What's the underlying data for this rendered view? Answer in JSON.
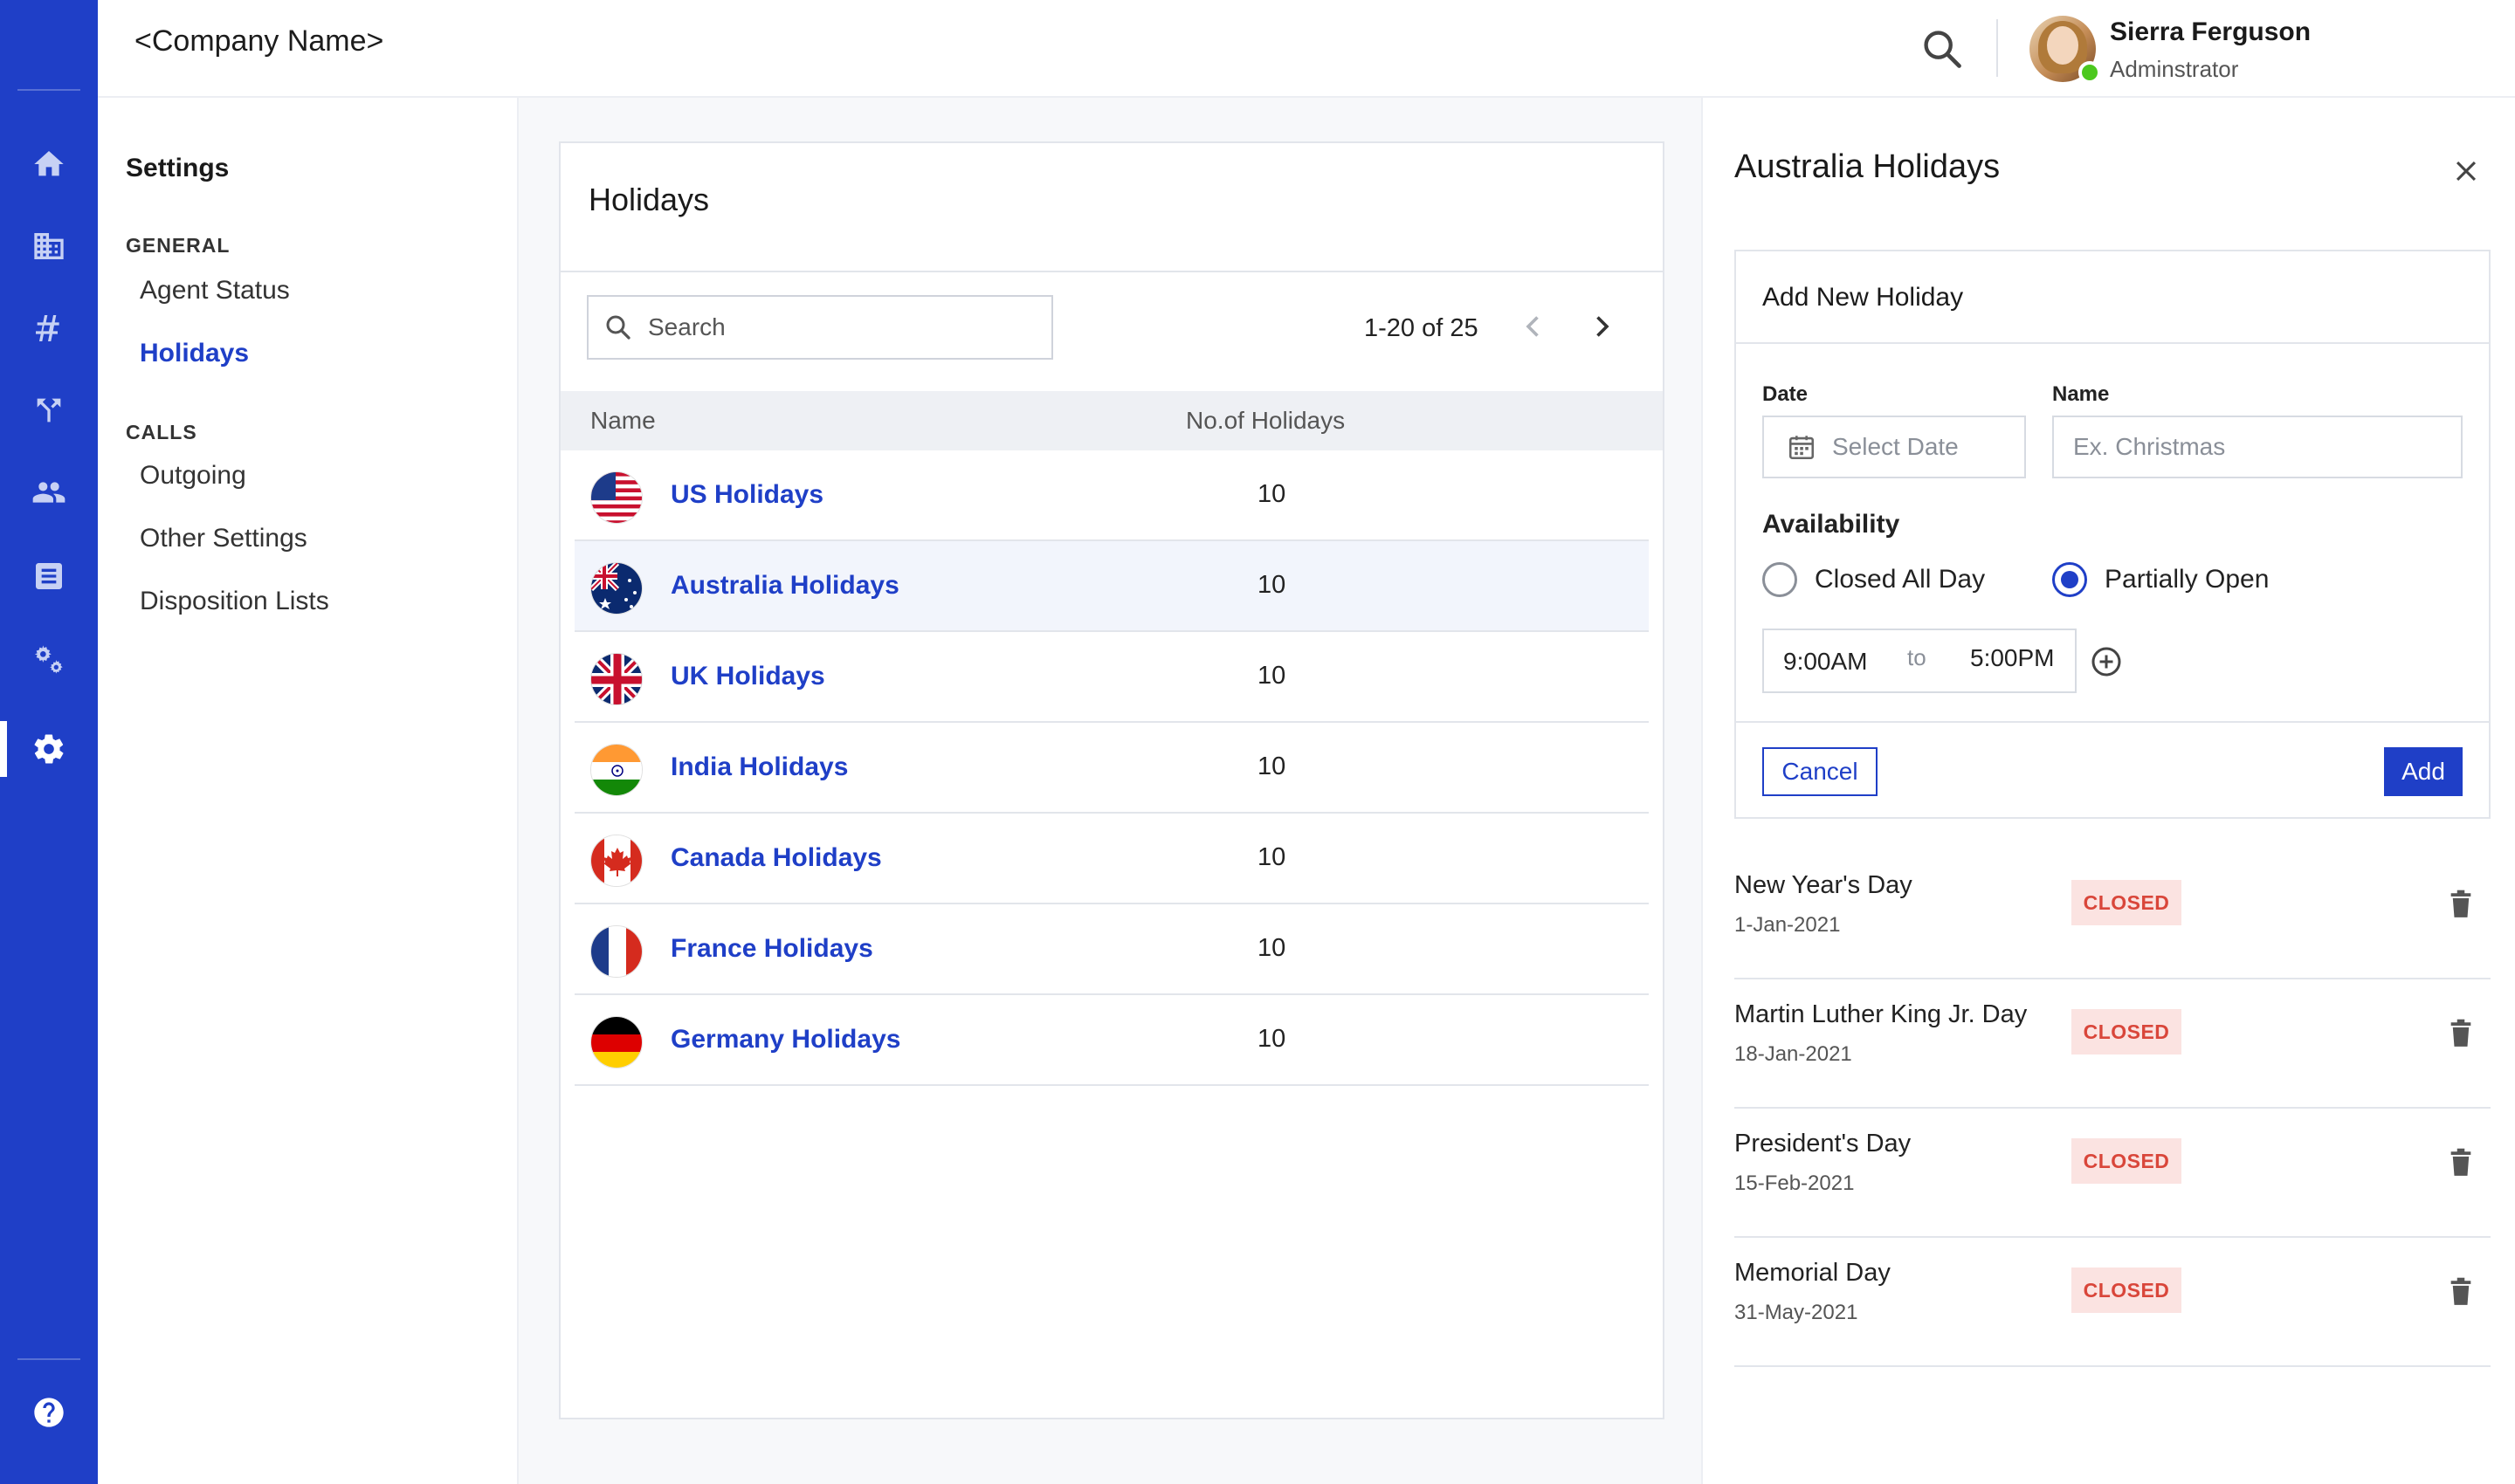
{
  "header": {
    "company_name": "<Company Name>",
    "user_name": "Sierra Ferguson",
    "user_role": "Adminstrator"
  },
  "rail": {
    "icons": [
      "home-icon",
      "building-icon",
      "hashtag-icon",
      "routing-icon",
      "users-icon",
      "list-icon",
      "automation-icon",
      "settings-icon",
      "help-icon"
    ],
    "active": "settings-icon",
    "color": "#1f3fc7"
  },
  "settings_nav": {
    "title": "Settings",
    "sections": [
      {
        "label": "GENERAL",
        "items": [
          "Agent Status",
          "Holidays"
        ]
      },
      {
        "label": "CALLS",
        "items": [
          "Outgoing",
          "Other Settings",
          "Disposition Lists"
        ]
      }
    ],
    "active_item": "Holidays"
  },
  "holidays_list": {
    "title": "Holidays",
    "search_placeholder": "Search",
    "pagination": "1-20 of 25",
    "columns": [
      "Name",
      "No.of Holidays"
    ],
    "rows": [
      {
        "name": "US Holidays",
        "count": "10",
        "flag": "us-flag-icon"
      },
      {
        "name": "Australia Holidays",
        "count": "10",
        "flag": "australia-flag-icon"
      },
      {
        "name": "UK Holidays",
        "count": "10",
        "flag": "uk-flag-icon"
      },
      {
        "name": "India Holidays",
        "count": "10",
        "flag": "india-flag-icon"
      },
      {
        "name": "Canada Holidays",
        "count": "10",
        "flag": "canada-flag-icon"
      },
      {
        "name": "France Holidays",
        "count": "10",
        "flag": "france-flag-icon"
      },
      {
        "name": "Germany Holidays",
        "count": "10",
        "flag": "germany-flag-icon"
      }
    ],
    "selected_row": "Australia Holidays"
  },
  "detail_panel": {
    "title": "Australia Holidays",
    "form": {
      "title": "Add New Holiday",
      "date_label": "Date",
      "date_placeholder": "Select Date",
      "name_label": "Name",
      "name_placeholder": "Ex. Christmas",
      "availability_label": "Availability",
      "options": [
        "Closed All Day",
        "Partially Open"
      ],
      "selected_option": "Partially Open",
      "time_start": "9:00AM",
      "time_separator": "to",
      "time_end": "5:00PM",
      "cancel_label": "Cancel",
      "add_label": "Add"
    },
    "holidays": [
      {
        "name": "New Year's Day",
        "date": "1-Jan-2021",
        "status": "CLOSED"
      },
      {
        "name": "Martin Luther King Jr. Day",
        "date": "18-Jan-2021",
        "status": "CLOSED"
      },
      {
        "name": "President's Day",
        "date": "15-Feb-2021",
        "status": "CLOSED"
      },
      {
        "name": "Memorial Day",
        "date": "31-May-2021",
        "status": "CLOSED"
      }
    ],
    "status_colors": {
      "closed_bg": "#fbe3e1",
      "closed_text": "#d9463a"
    }
  }
}
